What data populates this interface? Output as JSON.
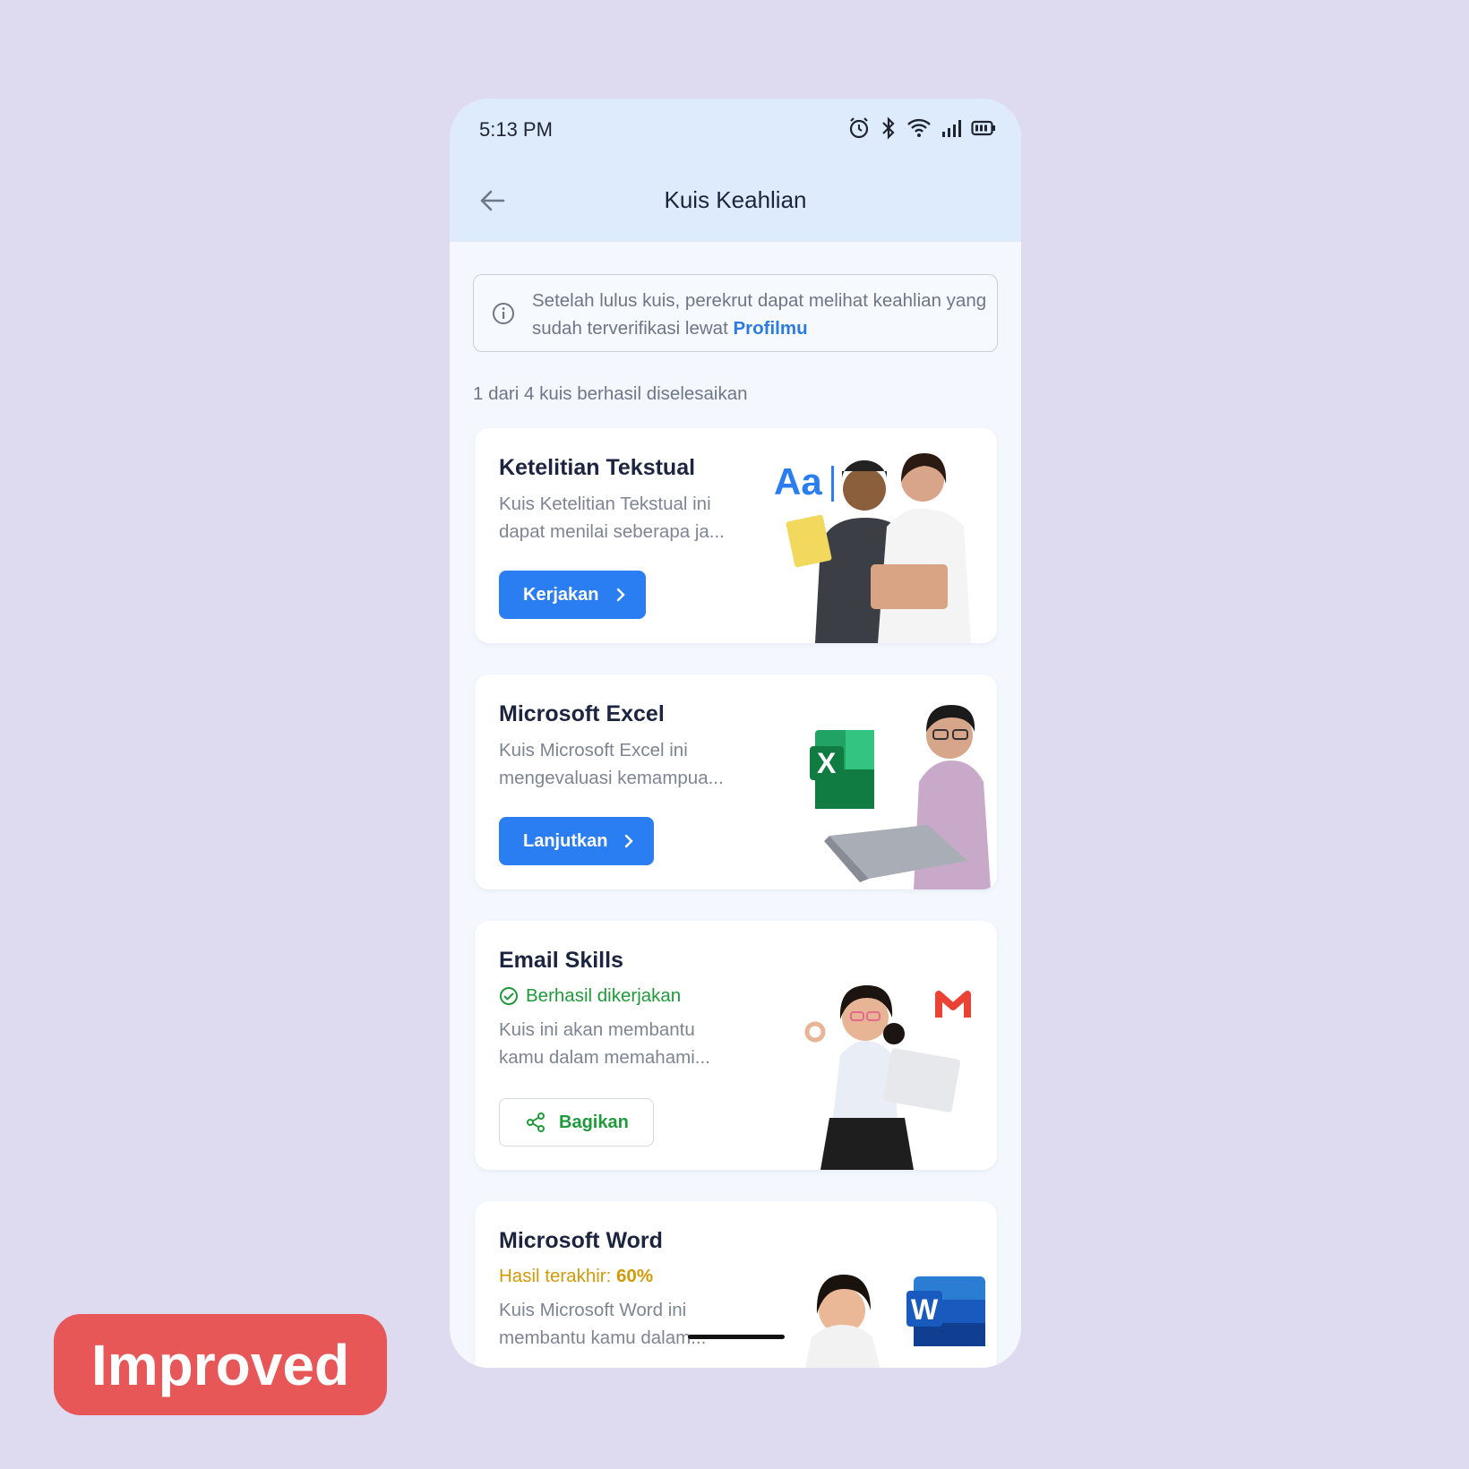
{
  "status_bar": {
    "time": "5:13 PM"
  },
  "header": {
    "title": "Kuis Keahlian"
  },
  "info": {
    "text": "Setelah lulus kuis, perekrut dapat melihat keahlian yang sudah terverifikasi lewat",
    "link": "Profilmu"
  },
  "progress_text": "1 dari 4 kuis berhasil diselesaikan",
  "cards": [
    {
      "title": "Ketelitian Tekstual",
      "desc_line1": "Kuis Ketelitian Tekstual ini",
      "desc_line2": "dapat menilai seberapa ja...",
      "button": "Kerjakan",
      "illus_text": "Aa"
    },
    {
      "title": "Microsoft Excel",
      "desc_line1": "Kuis Microsoft Excel ini",
      "desc_line2": "mengevaluasi kemampua...",
      "button": "Lanjutkan",
      "illus_text": "X"
    },
    {
      "title": "Email Skills",
      "status": "Berhasil dikerjakan",
      "desc_line1": "Kuis ini akan membantu",
      "desc_line2": "kamu dalam memahami...",
      "button": "Bagikan"
    },
    {
      "title": "Microsoft Word",
      "status_label": "Hasil terakhir:",
      "status_value": "60%",
      "desc_line1": "Kuis Microsoft Word ini",
      "desc_line2": "membantu kamu dalam...",
      "illus_text": "W"
    }
  ],
  "badge": "Improved",
  "colors": {
    "accent": "#2b7ef2",
    "success": "#1f9a3a",
    "warning": "#d39a06",
    "header_bg": "#ddebfc",
    "badge_bg": "#e85757"
  }
}
